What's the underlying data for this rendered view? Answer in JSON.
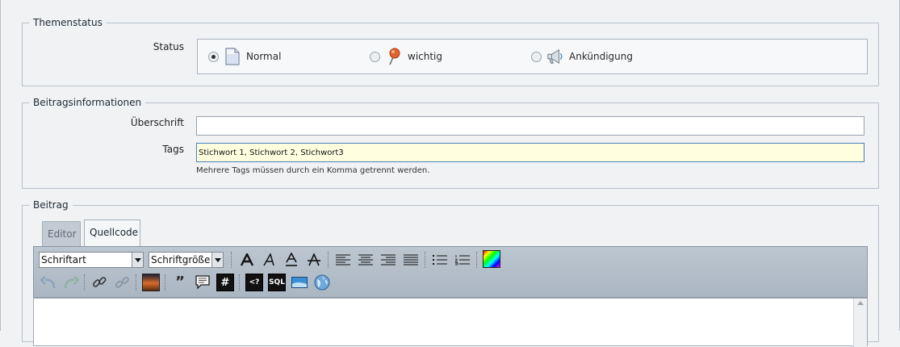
{
  "status_section": {
    "legend": "Themenstatus",
    "label": "Status",
    "options": [
      {
        "label": "Normal",
        "selected": true,
        "icon": "document-icon"
      },
      {
        "label": "wichtig",
        "selected": false,
        "icon": "pushpin-icon"
      },
      {
        "label": "Ankündigung",
        "selected": false,
        "icon": "megaphone-icon"
      }
    ]
  },
  "info_section": {
    "legend": "Beitragsinformationen",
    "title_label": "Überschrift",
    "title_value": "",
    "tags_label": "Tags",
    "tags_value": "Stichwort 1, Stichwort 2, Stichwort3",
    "tags_hint": "Mehrere Tags müssen durch ein Komma getrennt werden."
  },
  "post_section": {
    "legend": "Beitrag",
    "tabs": [
      {
        "label": "Editor",
        "active": false
      },
      {
        "label": "Quellcode",
        "active": true
      }
    ],
    "font_select": "Schriftart",
    "size_select": "Schriftgröße",
    "tb_code_text": "<?",
    "tb_sql_text": "SQL",
    "tb_hash_text": "#",
    "tb_quote_text": "”"
  },
  "colors": {
    "background": "#f0f2f4",
    "toolbar": "#b3bfca",
    "tags_input_bg": "#ffffe0",
    "tags_input_border": "#4c7fb6"
  }
}
